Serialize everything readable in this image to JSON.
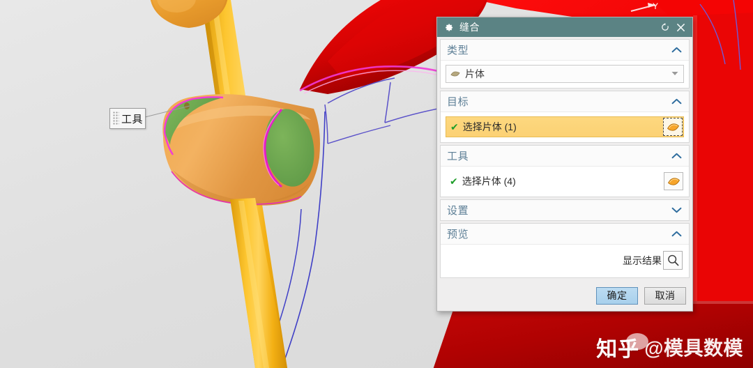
{
  "dialog": {
    "title": "缝合",
    "gear_icon": "gear-icon",
    "reset_icon": "reset-icon",
    "close_icon": "close-icon",
    "sections": [
      {
        "key": "type",
        "title": "类型",
        "chevron": "∧",
        "expanded": true,
        "combo_value": "片体",
        "combo_icon": "sheet-body-icon",
        "combo_arrow": "▾"
      },
      {
        "key": "target",
        "title": "目标",
        "chevron": "∧",
        "expanded": true,
        "row_check": "✔",
        "row_label": "选择片体 (1)",
        "row_icon": "select-sheet-body-icon"
      },
      {
        "key": "tool",
        "title": "工具",
        "chevron": "∧",
        "expanded": true,
        "row_check": "✔",
        "row_label": "选择片体 (4)",
        "row_icon": "select-sheet-body-icon"
      },
      {
        "key": "settings",
        "title": "设置",
        "chevron": "∨",
        "expanded": false
      },
      {
        "key": "preview",
        "title": "预览",
        "chevron": "∧",
        "expanded": true,
        "show_result_label": "显示结果",
        "show_result_icon": "magnifier-icon"
      }
    ],
    "footer": {
      "ok_label": "确定",
      "cancel_label": "取消"
    }
  },
  "viewport": {
    "callout": {
      "text": "工具",
      "grip_icon": "drag-grip-icon"
    },
    "axis": {
      "y_label": "Y"
    },
    "colors": {
      "background": "#e3e3e3",
      "sheet_red": "#e00000",
      "sheet_dark_red": "#b00000",
      "body_orange": "#eda martian",
      "shaft_yellow": "#f5b417",
      "face_green": "#6ba34e",
      "edge_magenta": "#e41ec6",
      "curve_blue": "#4141c8"
    }
  },
  "watermark": {
    "brand": "知乎",
    "user": "@模具数模",
    "logo_icon": "zhihu-logo-icon"
  }
}
